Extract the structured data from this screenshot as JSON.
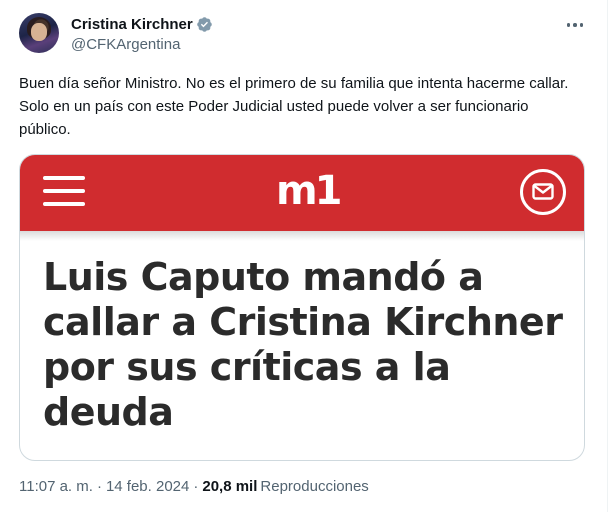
{
  "author": {
    "display_name": "Cristina Kirchner",
    "handle": "@CFKArgentina",
    "verified": true,
    "verified_color": "#829aab"
  },
  "tweet": {
    "text": "Buen día señor Ministro. No es el primero de su familia que intenta hacerme callar. Solo en un país con este Poder Judicial usted puede volver a ser funcionario público."
  },
  "card": {
    "brand_color": "#d02c2f",
    "logo": "m1",
    "menu_icon": "hamburger-menu-icon",
    "mail_icon": "envelope-icon",
    "headline": "Luis Caputo mandó a callar a Cristina Kirchner por sus críticas a la deuda"
  },
  "meta": {
    "time": "11:07 a. m.",
    "separator": "·",
    "date": "14 feb. 2024",
    "views_count": "20,8 mil",
    "views_label": "Reproducciones"
  },
  "icons": {
    "more": "more-options-icon",
    "verified": "verified-badge-icon"
  }
}
